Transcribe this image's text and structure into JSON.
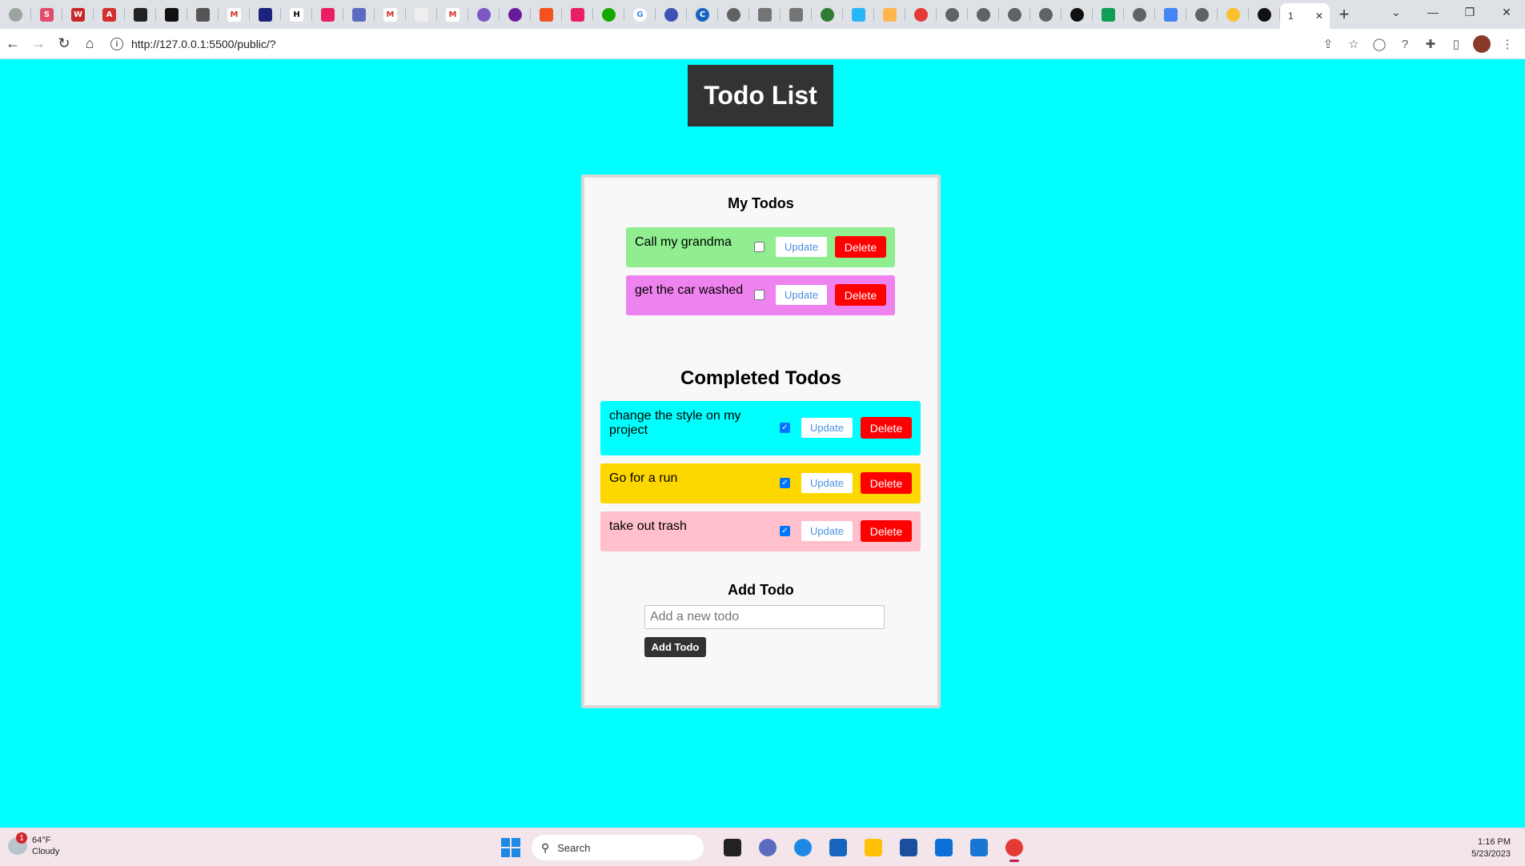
{
  "browser": {
    "active_tab_label": "1",
    "url": "http://127.0.0.1:5500/public/?"
  },
  "colors": {
    "page_bg": "#00ffff",
    "header_bg": "#333333",
    "delete_bg": "#ff0000"
  },
  "app": {
    "title": "Todo List",
    "my_todos_heading": "My Todos",
    "completed_heading": "Completed Todos",
    "add_heading": "Add Todo",
    "add_placeholder": "Add a new todo",
    "add_button": "Add Todo",
    "update_label": "Update",
    "delete_label": "Delete"
  },
  "my_todos": [
    {
      "text": "Call my grandma",
      "completed": false,
      "color": "#90ee90"
    },
    {
      "text": "get the car washed",
      "completed": false,
      "color": "#ee82ee"
    }
  ],
  "completed_todos": [
    {
      "text": "change the style on my project",
      "completed": true,
      "color": "#00ffff"
    },
    {
      "text": "Go for a run",
      "completed": true,
      "color": "#ffd700"
    },
    {
      "text": "take out trash",
      "completed": true,
      "color": "#ffc0cb"
    }
  ],
  "taskbar": {
    "weather_temp": "64°F",
    "weather_cond": "Cloudy",
    "weather_badge": "1",
    "search_label": "Search",
    "time": "1:16 PM",
    "date": "5/23/2023"
  }
}
